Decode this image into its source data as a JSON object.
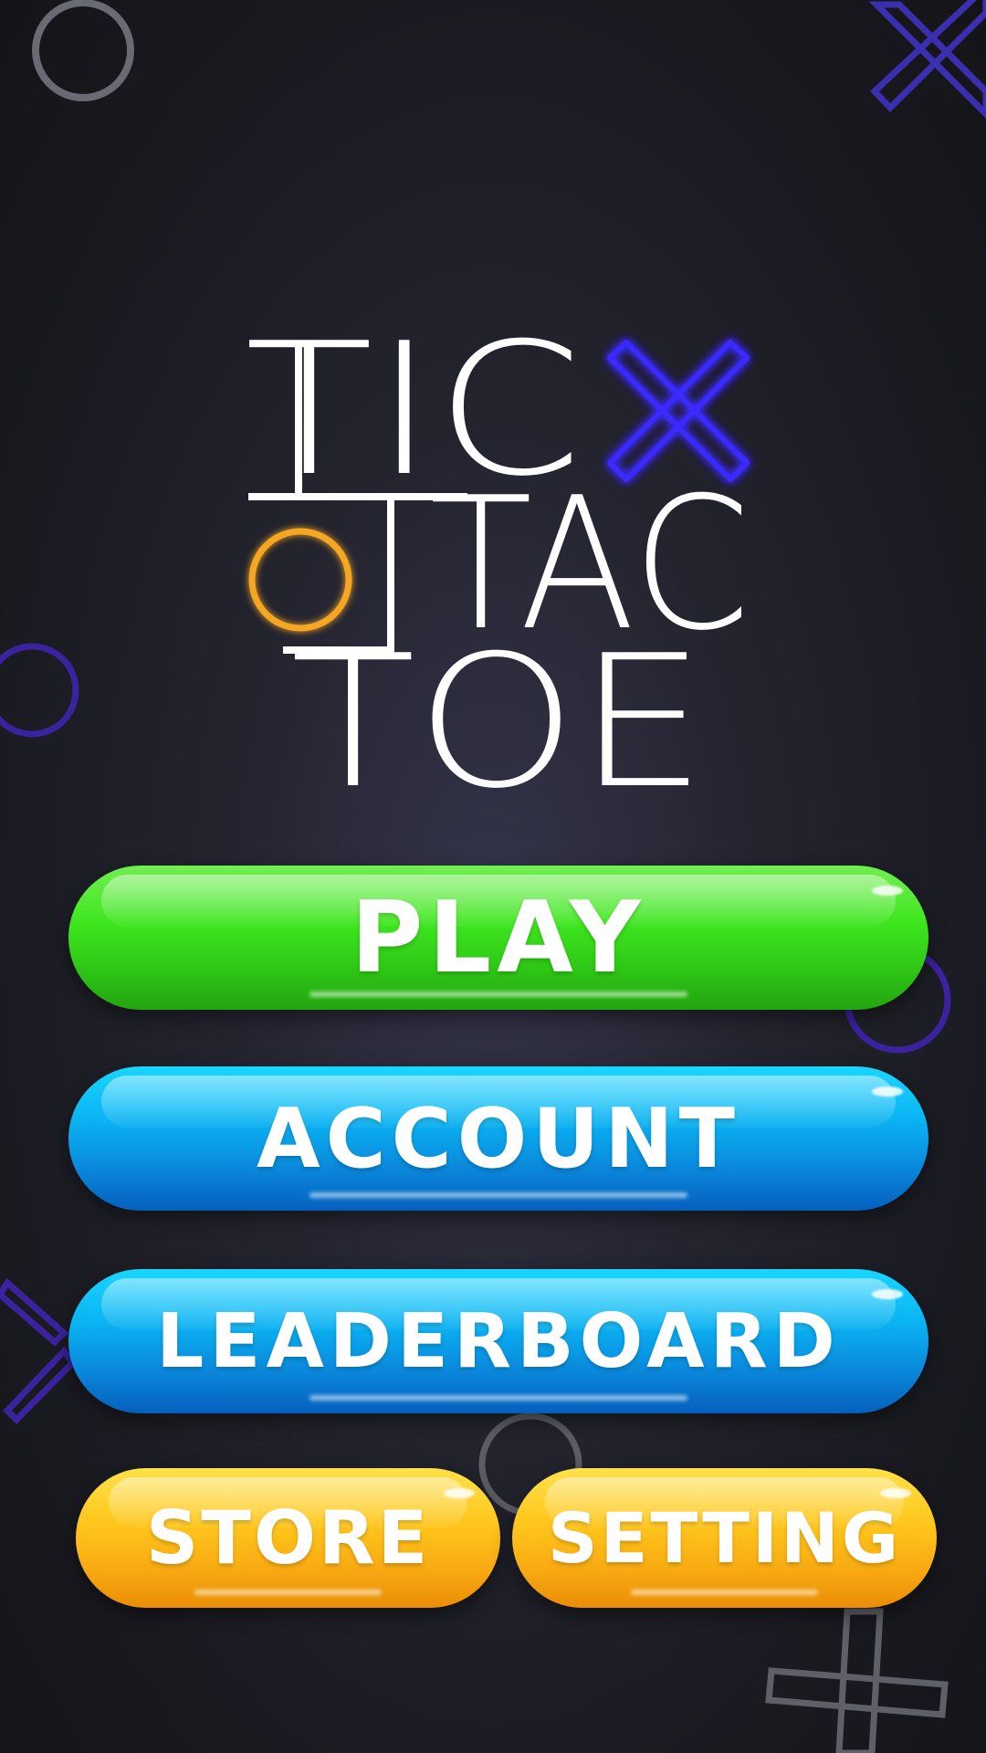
{
  "title": {
    "line1": "TIC",
    "line2": "TAC",
    "line3": "TOE"
  },
  "buttons": {
    "play": "PLAY",
    "account": "ACCOUNT",
    "leaderboard": "LEADERBOARD",
    "store": "STORE",
    "setting": "SETTING"
  },
  "colors": {
    "play_button": "#3ee61e",
    "account_button": "#0ab2f2",
    "leaderboard_button": "#0ab2f2",
    "store_button": "#ffc61c",
    "setting_button": "#ffc61c",
    "title_x_mark": "#3a2cff",
    "title_o_mark": "#f5a623",
    "background": "#1c1c24"
  },
  "icons": {
    "title_x": "x-mark-icon",
    "title_o": "o-mark-icon"
  }
}
